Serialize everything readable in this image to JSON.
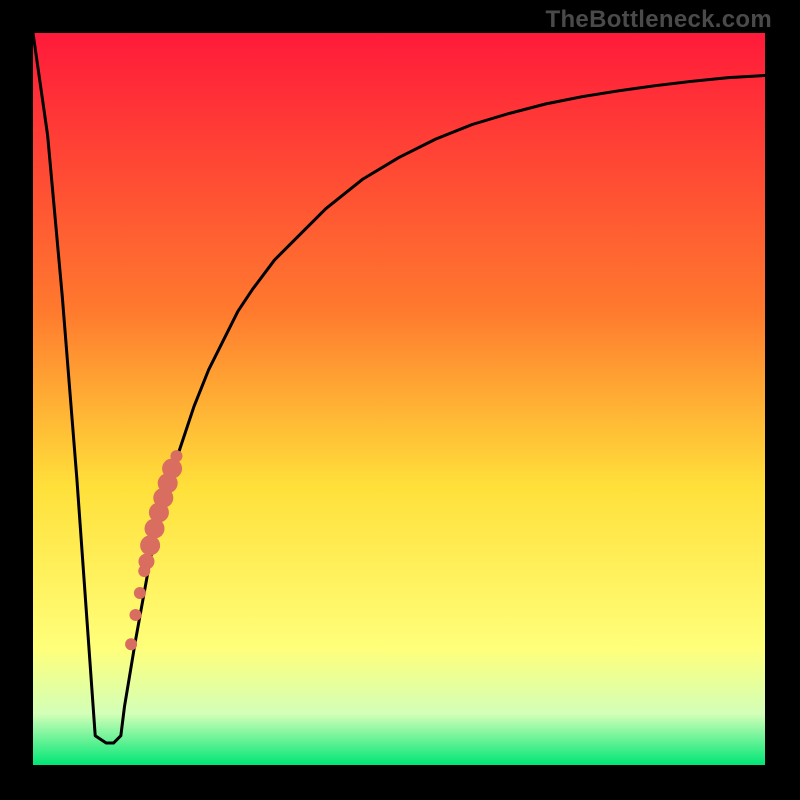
{
  "watermark": "TheBottleneck.com",
  "colors": {
    "gradient_top": "#ff1a3a",
    "gradient_mid1": "#ff7a2e",
    "gradient_mid2": "#ffe03a",
    "gradient_mid3": "#ffff7a",
    "gradient_mid4": "#d3ffb8",
    "gradient_bottom": "#00e676",
    "curve": "#000000",
    "marker": "#d86d60",
    "frame": "#000000"
  },
  "chart_data": {
    "type": "line",
    "title": "",
    "xlabel": "",
    "ylabel": "",
    "xlim": [
      0,
      100
    ],
    "ylim": [
      0,
      100
    ],
    "series": [
      {
        "name": "bottleneck-curve",
        "x": [
          0,
          2,
          4,
          6,
          8.5,
          10,
          11,
          12,
          12.5,
          14,
          16,
          18,
          20,
          22,
          24,
          26,
          28,
          30,
          33,
          36,
          40,
          45,
          50,
          55,
          60,
          65,
          70,
          75,
          80,
          85,
          90,
          95,
          100
        ],
        "y": [
          100,
          86,
          64,
          39,
          4,
          3,
          3,
          4,
          8,
          17,
          28,
          37,
          43,
          49,
          54,
          58,
          62,
          65,
          69,
          72,
          76,
          80,
          83,
          85.5,
          87.5,
          89,
          90.3,
          91.3,
          92.1,
          92.8,
          93.4,
          93.9,
          94.2
        ]
      }
    ],
    "markers": {
      "name": "highlight-segment",
      "points": [
        {
          "x": 19.6,
          "y": 42.2,
          "r": 6
        },
        {
          "x": 19.0,
          "y": 40.5,
          "r": 10
        },
        {
          "x": 18.4,
          "y": 38.5,
          "r": 10
        },
        {
          "x": 17.8,
          "y": 36.5,
          "r": 10
        },
        {
          "x": 17.2,
          "y": 34.5,
          "r": 10
        },
        {
          "x": 16.6,
          "y": 32.3,
          "r": 10
        },
        {
          "x": 16.0,
          "y": 30.0,
          "r": 10
        },
        {
          "x": 15.5,
          "y": 27.8,
          "r": 8
        },
        {
          "x": 15.2,
          "y": 26.5,
          "r": 6
        },
        {
          "x": 14.6,
          "y": 23.5,
          "r": 6
        },
        {
          "x": 14.0,
          "y": 20.5,
          "r": 6
        },
        {
          "x": 13.4,
          "y": 16.5,
          "r": 6
        }
      ]
    }
  }
}
